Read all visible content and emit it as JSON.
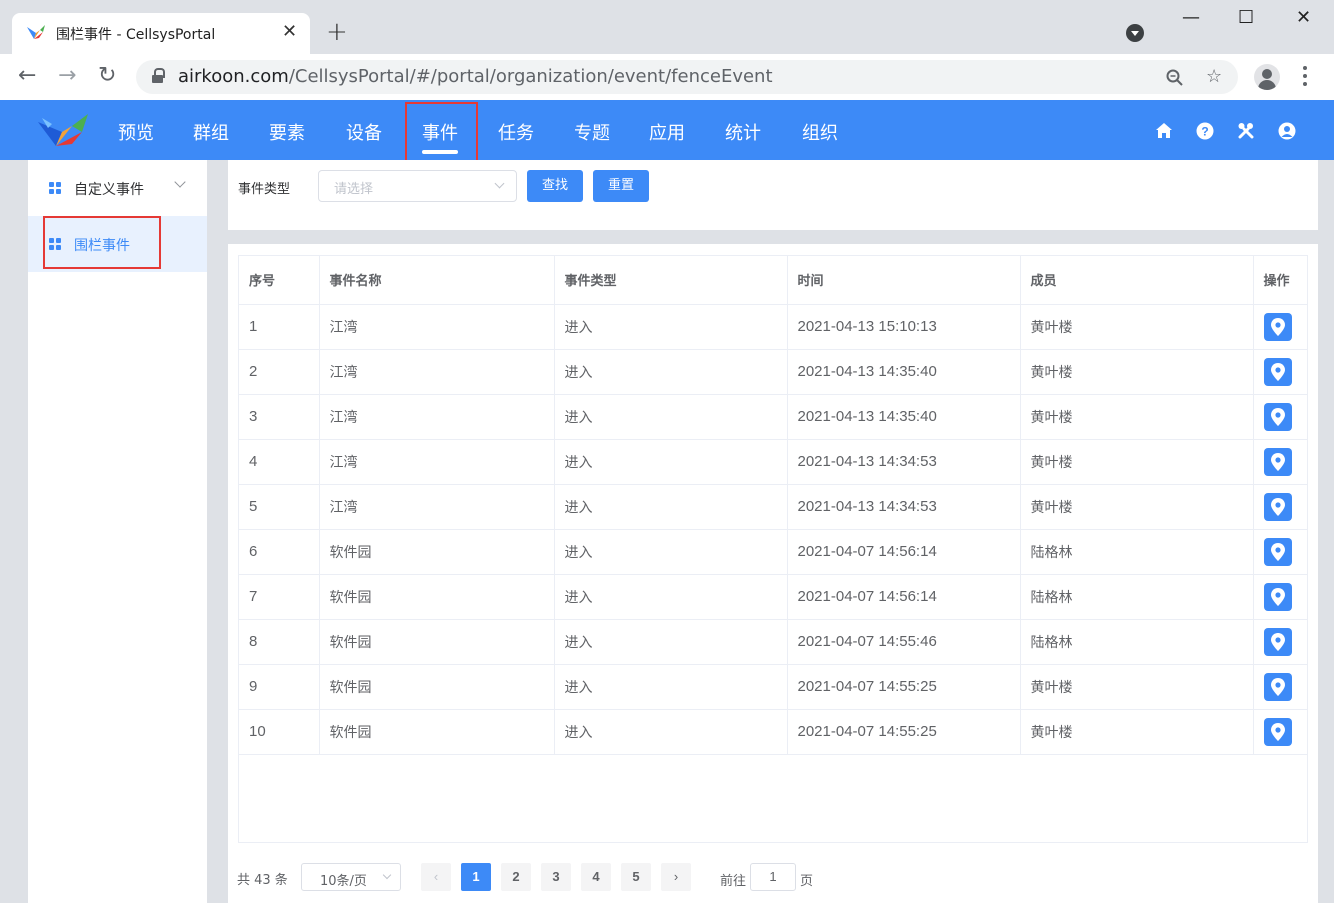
{
  "browser": {
    "tab_title": "围栏事件 - CellsysPortal",
    "tab_close": "✕",
    "new_tab": "+",
    "url_host": "airkoon.com",
    "url_path": "/CellsysPortal/#/portal/organization/event/fenceEvent",
    "window_controls": {
      "minimize": "—",
      "maximize": "☐",
      "close": "✕"
    }
  },
  "header": {
    "nav": [
      {
        "label": "预览"
      },
      {
        "label": "群组"
      },
      {
        "label": "要素"
      },
      {
        "label": "设备"
      },
      {
        "label": "事件",
        "active": true
      },
      {
        "label": "任务"
      },
      {
        "label": "专题"
      },
      {
        "label": "应用"
      },
      {
        "label": "统计"
      },
      {
        "label": "组织"
      }
    ],
    "icons": [
      "home-icon",
      "help-icon",
      "tools-icon",
      "user-icon"
    ],
    "accent_color": "#3d8af7"
  },
  "sidebar": {
    "items": [
      {
        "label": "自定义事件",
        "expandable": true
      },
      {
        "label": "围栏事件",
        "active": true
      }
    ]
  },
  "filter": {
    "label": "事件类型",
    "placeholder": "请选择",
    "search_label": "查找",
    "reset_label": "重置"
  },
  "table": {
    "columns": [
      "序号",
      "事件名称",
      "事件类型",
      "时间",
      "成员",
      "操作"
    ],
    "rows": [
      {
        "no": "1",
        "name": "江湾",
        "type": "进入",
        "time": "2021-04-13 15:10:13",
        "member": "黄叶楼"
      },
      {
        "no": "2",
        "name": "江湾",
        "type": "进入",
        "time": "2021-04-13 14:35:40",
        "member": "黄叶楼"
      },
      {
        "no": "3",
        "name": "江湾",
        "type": "进入",
        "time": "2021-04-13 14:35:40",
        "member": "黄叶楼"
      },
      {
        "no": "4",
        "name": "江湾",
        "type": "进入",
        "time": "2021-04-13 14:34:53",
        "member": "黄叶楼"
      },
      {
        "no": "5",
        "name": "江湾",
        "type": "进入",
        "time": "2021-04-13 14:34:53",
        "member": "黄叶楼"
      },
      {
        "no": "6",
        "name": "软件园",
        "type": "进入",
        "time": "2021-04-07 14:56:14",
        "member": "陆格林"
      },
      {
        "no": "7",
        "name": "软件园",
        "type": "进入",
        "time": "2021-04-07 14:56:14",
        "member": "陆格林"
      },
      {
        "no": "8",
        "name": "软件园",
        "type": "进入",
        "time": "2021-04-07 14:55:46",
        "member": "陆格林"
      },
      {
        "no": "9",
        "name": "软件园",
        "type": "进入",
        "time": "2021-04-07 14:55:25",
        "member": "黄叶楼"
      },
      {
        "no": "10",
        "name": "软件园",
        "type": "进入",
        "time": "2021-04-07 14:55:25",
        "member": "黄叶楼"
      }
    ]
  },
  "pagination": {
    "total_text": "共 43 条",
    "page_size": "10条/页",
    "prev": "‹",
    "next": "›",
    "pages": [
      "1",
      "2",
      "3",
      "4",
      "5"
    ],
    "current_page": "1",
    "goto_prefix": "前往",
    "goto_value": "1",
    "goto_suffix": "页"
  }
}
